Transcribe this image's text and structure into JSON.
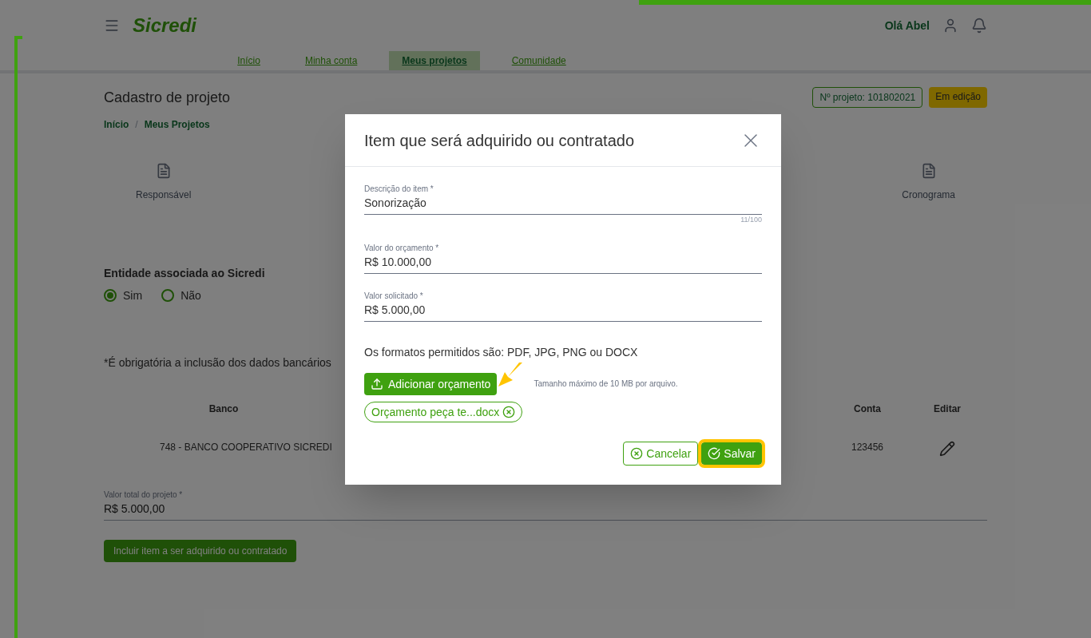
{
  "header": {
    "logo": "Sicredi",
    "greeting": "Olá Abel"
  },
  "nav": [
    {
      "label": "Início",
      "selected": false
    },
    {
      "label": "Minha conta",
      "selected": false
    },
    {
      "label": "Meus projetos",
      "selected": true
    },
    {
      "label": "Comunidade",
      "selected": false
    }
  ],
  "page": {
    "title": "Cadastro de projeto",
    "badges": [
      {
        "text": "Nº projeto: 101802021",
        "kind": "outline"
      },
      {
        "text": "Em edição",
        "kind": "status"
      }
    ],
    "breadcrumb": {
      "items": [
        "Início",
        "Meus Projetos"
      ],
      "separator": "/"
    },
    "steps": [
      {
        "label": "Responsável"
      },
      {
        "label": "Cronograma"
      }
    ],
    "association": {
      "label": "Entidade associada ao Sicredi",
      "options": [
        {
          "label": "Sim",
          "selected": true
        },
        {
          "label": "Não",
          "selected": false
        }
      ]
    },
    "note": "*É obrigatória a inclusão dos dados bancários",
    "table": {
      "columns": [
        "Banco",
        "Conta",
        "Editar"
      ],
      "rows": [
        [
          "748 - BANCO COOPERATIVO SICREDI",
          "123456"
        ]
      ]
    },
    "total": {
      "label": "Valor total do projeto *",
      "value": "R$ 5.000,00"
    },
    "add_button": "Incluir item a ser adquirido ou contratado"
  },
  "modal": {
    "title": "Item que será adquirido ou contratado",
    "fields": [
      {
        "label": "Descrição do item *",
        "value": "Sonorização",
        "counter": "11/100"
      },
      {
        "label": "Valor do orçamento *",
        "value": "R$ 10.000,00"
      },
      {
        "label": "Valor solicitado *",
        "value": "R$ 5.000,00"
      }
    ],
    "formats_note": "Os formatos permitidos são: PDF, JPG, PNG ou DOCX",
    "upload_button": "Adicionar orçamento",
    "upload_hint": "Tamanho máximo de 10 MB por arquivo.",
    "attachments": [
      {
        "name": "Orçamento peça te...docx"
      }
    ],
    "buttons": [
      {
        "label": "Cancelar",
        "kind": "secondary",
        "highlighted": false
      },
      {
        "label": "Salvar",
        "kind": "primary",
        "highlighted": true
      }
    ]
  }
}
